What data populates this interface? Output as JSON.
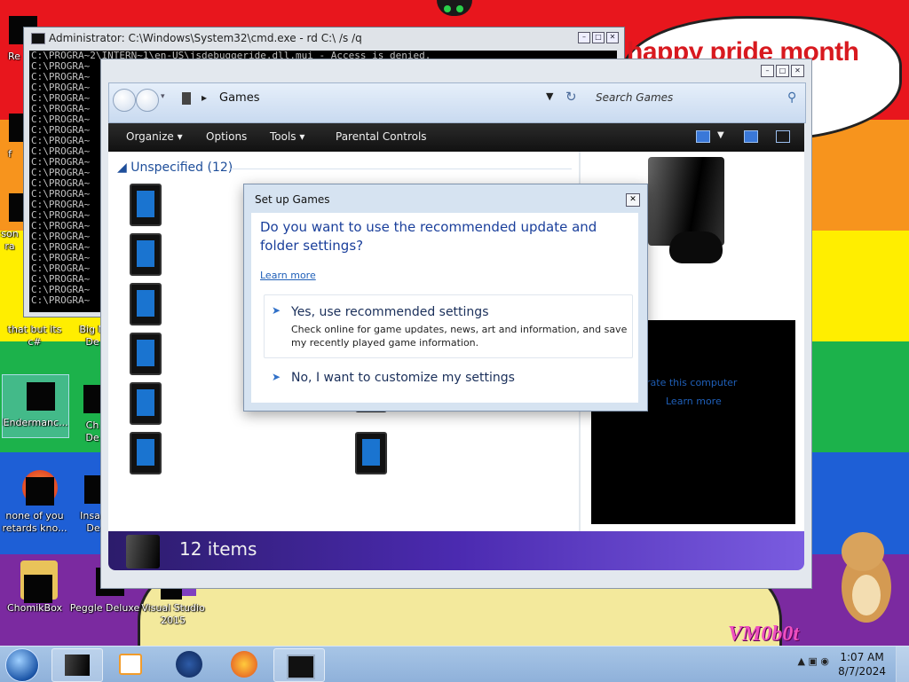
{
  "wallpaper": {
    "bubble_text": "happy pride month",
    "watermark": "VM0b0t",
    "colors": [
      "#e8161d",
      "#f7941d",
      "#ffee00",
      "#1cb24b",
      "#1e5fd6",
      "#7b2aa0"
    ]
  },
  "desktop_icons": [
    {
      "label": "Re",
      "icon": "app-icon"
    },
    {
      "label": "",
      "icon": "app-icon"
    },
    {
      "label": "son",
      "icon": "app-icon"
    },
    {
      "label": "ra",
      "icon": "app-icon"
    },
    {
      "label": "that but its c#",
      "icon": "app-icon"
    },
    {
      "label": "Big N",
      "sub": "De",
      "icon": "app-icon"
    },
    {
      "label": "Endermanc...",
      "icon": "app-icon"
    },
    {
      "label": "Ch",
      "sub": "De",
      "icon": "app-icon"
    },
    {
      "label": "none of you retards kno...",
      "icon": "firefox-icon"
    },
    {
      "label": "Insan",
      "sub": "De",
      "icon": "app-icon"
    },
    {
      "label": "ChomikBox",
      "icon": "chomikbox-icon"
    },
    {
      "label": "Peggle Deluxe",
      "icon": "peggle-icon"
    },
    {
      "label": "Visual Studio 2015",
      "icon": "visual-studio-icon"
    }
  ],
  "cmd_window": {
    "title": "Administrator: C:\\Windows\\System32\\cmd.exe - rd  C:\\ /s /q",
    "lines": [
      "C:\\PROGRA~2\\INTERN~1\\en-US\\jsdebuggeride.dll.mui - Access is denied.",
      "C:\\PROGRA~",
      "C:\\PROGRA~",
      "C:\\PROGRA~",
      "C:\\PROGRA~",
      "C:\\PROGRA~",
      "C:\\PROGRA~",
      "C:\\PROGRA~",
      "C:\\PROGRA~",
      "C:\\PROGRA~",
      "C:\\PROGRA~",
      "C:\\PROGRA~",
      "C:\\PROGRA~",
      "C:\\PROGRA~",
      "C:\\PROGRA~",
      "C:\\PROGRA~",
      "C:\\PROGRA~",
      "C:\\PROGRA~",
      "C:\\PROGRA~",
      "C:\\PROGRA~",
      "C:\\PROGRA~",
      "C:\\PROGRA~",
      "C:\\PROGRA~",
      "C:\\PROGRA~"
    ],
    "buttons": [
      "minimize-icon",
      "maximize-icon",
      "close-icon"
    ]
  },
  "explorer": {
    "address": "Games",
    "search_placeholder": "Search Games",
    "toolbar": {
      "organize": "Organize",
      "options": "Options",
      "tools": "Tools",
      "parental_controls": "Parental Controls"
    },
    "group_header": "Unspecified (12)",
    "preview_link1": "rate this computer",
    "preview_link2": "Learn more",
    "status": "12 items"
  },
  "dialog": {
    "title": "Set up Games",
    "question": "Do you want to use the recommended update and folder settings?",
    "learn_more": "Learn more",
    "option1_title": "Yes, use recommended settings",
    "option1_desc": "Check online for game updates, news, art and information, and save my recently played game information.",
    "option2_title": "No, I want to customize my settings"
  },
  "taskbar": {
    "apps": [
      "explorer-icon",
      "media-player-icon",
      "network-icon",
      "firefox-icon",
      "cmd-icon"
    ],
    "time": "1:07 AM",
    "date": "8/7/2024"
  }
}
